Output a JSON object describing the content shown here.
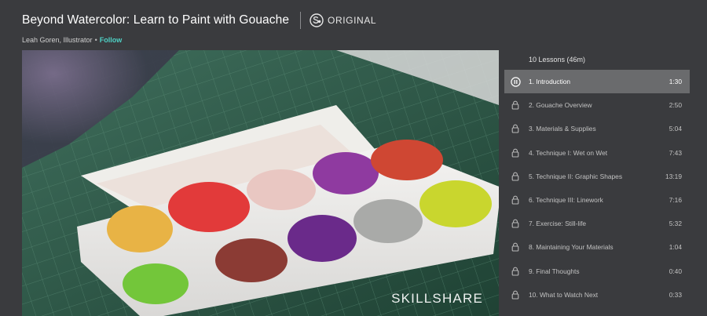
{
  "course": {
    "title": "Beyond Watercolor: Learn to Paint with Gouache",
    "badge_label": "ORIGINAL",
    "author": "Leah Goren, Illustrator",
    "separator": "•",
    "follow_label": "Follow"
  },
  "video": {
    "watermark": "SKILLSHARE"
  },
  "lessons_header": "10 Lessons (46m)",
  "lessons": [
    {
      "title": "1. Introduction",
      "duration": "1:30",
      "state": "playing"
    },
    {
      "title": "2. Gouache Overview",
      "duration": "2:50",
      "state": "locked"
    },
    {
      "title": "3. Materials & Supplies",
      "duration": "5:04",
      "state": "locked"
    },
    {
      "title": "4. Technique I: Wet on Wet",
      "duration": "7:43",
      "state": "locked"
    },
    {
      "title": "5. Technique II: Graphic Shapes",
      "duration": "13:19",
      "state": "locked"
    },
    {
      "title": "6. Technique III: Linework",
      "duration": "7:16",
      "state": "locked"
    },
    {
      "title": "7. Exercise: Still-life",
      "duration": "5:32",
      "state": "locked"
    },
    {
      "title": "8. Maintaining Your Materials",
      "duration": "1:04",
      "state": "locked"
    },
    {
      "title": "9. Final Thoughts",
      "duration": "0:40",
      "state": "locked"
    },
    {
      "title": "10. What to Watch Next",
      "duration": "0:33",
      "state": "locked"
    }
  ],
  "colors": {
    "background": "#3a3b3e",
    "active_row": "#6a6b6d",
    "follow": "#4fd1c5"
  }
}
